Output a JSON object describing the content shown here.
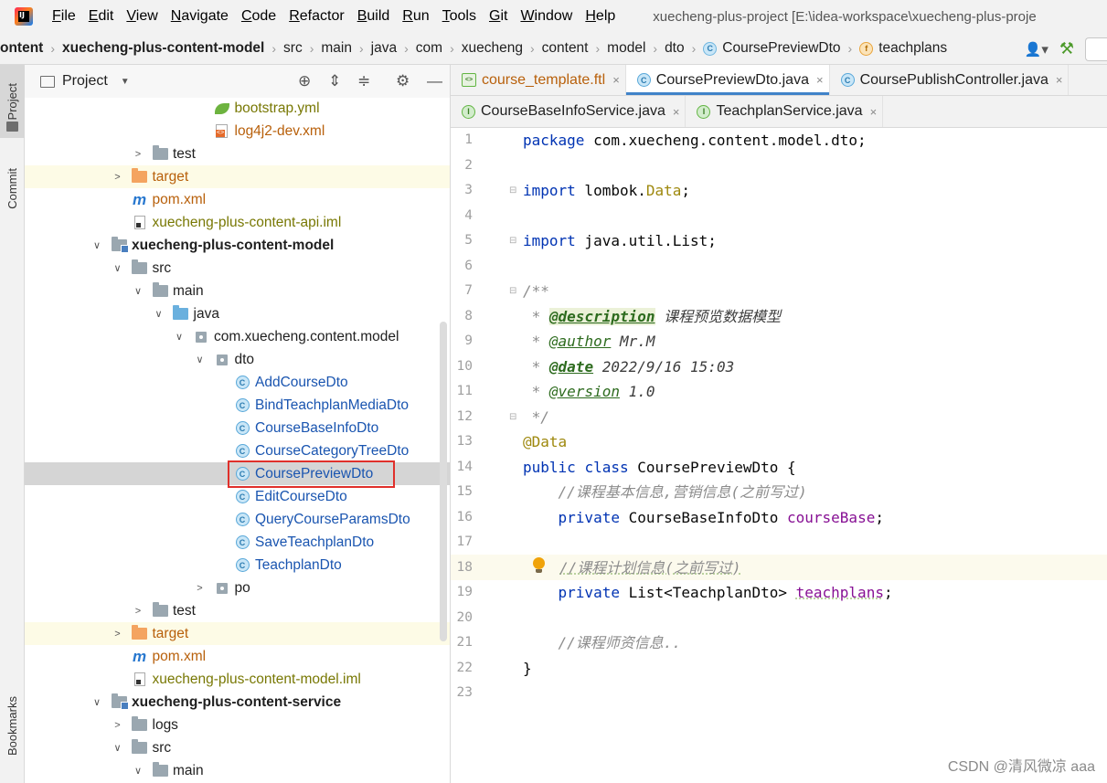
{
  "menubar": {
    "items": [
      {
        "first": "F",
        "rest": "ile"
      },
      {
        "first": "E",
        "rest": "dit"
      },
      {
        "first": "V",
        "rest": "iew"
      },
      {
        "first": "N",
        "rest": "avigate"
      },
      {
        "first": "C",
        "rest": "ode"
      },
      {
        "first": "R",
        "rest": "efactor"
      },
      {
        "first": "B",
        "rest": "uild"
      },
      {
        "first": "R",
        "rest": "un"
      },
      {
        "first": "T",
        "rest": "ools"
      },
      {
        "first": "G",
        "rest": "it"
      },
      {
        "first": "W",
        "rest": "indow"
      },
      {
        "first": "H",
        "rest": "elp"
      }
    ],
    "window_title": "xuecheng-plus-project [E:\\idea-workspace\\xuecheng-plus-proje"
  },
  "breadcrumb": {
    "items": [
      "ontent",
      "xuecheng-plus-content-model",
      "src",
      "main",
      "java",
      "com",
      "xuecheng",
      "content",
      "model",
      "dto",
      "CoursePreviewDto",
      "teachplans"
    ],
    "class_icon": "C",
    "field_icon": "f"
  },
  "left_strip": {
    "project": "Project",
    "commit": "Commit",
    "bookmarks": "Bookmarks"
  },
  "project_panel": {
    "title": "Project"
  },
  "tree": [
    {
      "label": "bootstrap.yml",
      "icon": "spring-leaf",
      "depth": 7,
      "style": "spring"
    },
    {
      "label": "log4j2-dev.xml",
      "icon": "xml-file",
      "depth": 7,
      "style": "orange"
    },
    {
      "label": "test",
      "icon": "folder",
      "depth": 4,
      "arrow": "›"
    },
    {
      "label": "target",
      "icon": "folder-orange",
      "depth": 3,
      "arrow": "›",
      "highlight": "yellow",
      "style": "orange"
    },
    {
      "label": "pom.xml",
      "icon": "maven",
      "depth": 3,
      "style": "orange"
    },
    {
      "label": "xuecheng-plus-content-api.iml",
      "icon": "iml-file",
      "depth": 3,
      "style": "olive"
    },
    {
      "label": "xuecheng-plus-content-model",
      "icon": "module-folder",
      "depth": 2,
      "arrow": "⌄",
      "bold": true
    },
    {
      "label": "src",
      "icon": "folder",
      "depth": 3,
      "arrow": "⌄"
    },
    {
      "label": "main",
      "icon": "folder",
      "depth": 4,
      "arrow": "⌄"
    },
    {
      "label": "java",
      "icon": "folder-blue",
      "depth": 5,
      "arrow": "⌄"
    },
    {
      "label": "com.xuecheng.content.model",
      "icon": "package",
      "depth": 6,
      "arrow": "⌄"
    },
    {
      "label": "dto",
      "icon": "package",
      "depth": 7,
      "arrow": "⌄"
    },
    {
      "label": "AddCourseDto",
      "icon": "class",
      "depth": 8,
      "style": "blue"
    },
    {
      "label": "BindTeachplanMediaDto",
      "icon": "class",
      "depth": 8,
      "style": "blue"
    },
    {
      "label": "CourseBaseInfoDto",
      "icon": "class",
      "depth": 8,
      "style": "blue"
    },
    {
      "label": "CourseCategoryTreeDto",
      "icon": "class",
      "depth": 8,
      "style": "blue"
    },
    {
      "label": "CoursePreviewDto",
      "icon": "class",
      "depth": 8,
      "style": "blue",
      "selected": true
    },
    {
      "label": "EditCourseDto",
      "icon": "class",
      "depth": 8,
      "style": "blue"
    },
    {
      "label": "QueryCourseParamsDto",
      "icon": "class",
      "depth": 8,
      "style": "blue"
    },
    {
      "label": "SaveTeachplanDto",
      "icon": "class",
      "depth": 8,
      "style": "blue"
    },
    {
      "label": "TeachplanDto",
      "icon": "class",
      "depth": 8,
      "style": "blue"
    },
    {
      "label": "po",
      "icon": "package",
      "depth": 7,
      "arrow": "›"
    },
    {
      "label": "test",
      "icon": "folder",
      "depth": 4,
      "arrow": "›"
    },
    {
      "label": "target",
      "icon": "folder-orange",
      "depth": 3,
      "arrow": "›",
      "highlight": "yellow",
      "style": "orange"
    },
    {
      "label": "pom.xml",
      "icon": "maven",
      "depth": 3,
      "style": "orange"
    },
    {
      "label": "xuecheng-plus-content-model.iml",
      "icon": "iml-file",
      "depth": 3,
      "style": "olive"
    },
    {
      "label": "xuecheng-plus-content-service",
      "icon": "module-folder",
      "depth": 2,
      "arrow": "⌄",
      "bold": true
    },
    {
      "label": "logs",
      "icon": "folder",
      "depth": 3,
      "arrow": "›"
    },
    {
      "label": "src",
      "icon": "folder",
      "depth": 3,
      "arrow": "⌄"
    },
    {
      "label": "main",
      "icon": "folder",
      "depth": 4,
      "arrow": "⌄"
    }
  ],
  "editor_tabs": {
    "row1": [
      {
        "label": "course_template.ftl",
        "icon": "ftl",
        "icon_text": "<>",
        "style": "orange"
      },
      {
        "label": "CoursePreviewDto.java",
        "icon": "c",
        "icon_text": "C",
        "active": true
      },
      {
        "label": "CoursePublishController.java",
        "icon": "c",
        "icon_text": "C"
      }
    ],
    "row2": [
      {
        "label": "CourseBaseInfoService.java",
        "icon": "i",
        "icon_text": "I"
      },
      {
        "label": "TeachplanService.java",
        "icon": "i",
        "icon_text": "I"
      }
    ],
    "close_glyph": "×"
  },
  "code": {
    "line_numbers": [
      "1",
      "2",
      "3",
      "4",
      "5",
      "6",
      "7",
      "8",
      "9",
      "10",
      "11",
      "12",
      "13",
      "14",
      "15",
      "16",
      "17",
      "18",
      "19",
      "20",
      "21",
      "22",
      "23"
    ],
    "package_kw": "package",
    "package_name": " com.xuecheng.content.model.dto;",
    "import_kw": "import",
    "import1_pre": " lombok.",
    "import1_cls": "Data",
    "import1_post": ";",
    "import2": " java.util.List;",
    "doc_open": "/**",
    "doc_star": " * ",
    "tag_description": "@description",
    "val_description": " 课程预览数据模型",
    "tag_author": "@author",
    "val_author": " Mr.M",
    "tag_date": "@date",
    "val_date": " 2022/9/16 15:03",
    "tag_version": "@version",
    "val_version": " 1.0",
    "doc_close": " */",
    "annotation": "@Data",
    "public_kw": "public",
    "class_kw": "class",
    "class_name": " CoursePreviewDto {",
    "comment1": "    //课程基本信息,营销信息(之前写过)",
    "private_kw": "    private",
    "field1_type": " CourseBaseInfoDto ",
    "field1_name": "courseBase",
    "semicolon": ";",
    "comment2": "//课程计划信息(之前写过)",
    "field2_type": " List<TeachplanDto> ",
    "field2_name": "teachplans",
    "comment3": "    //课程师资信息..",
    "close_brace": "}"
  },
  "watermark": "CSDN @清风微凉 aaa"
}
